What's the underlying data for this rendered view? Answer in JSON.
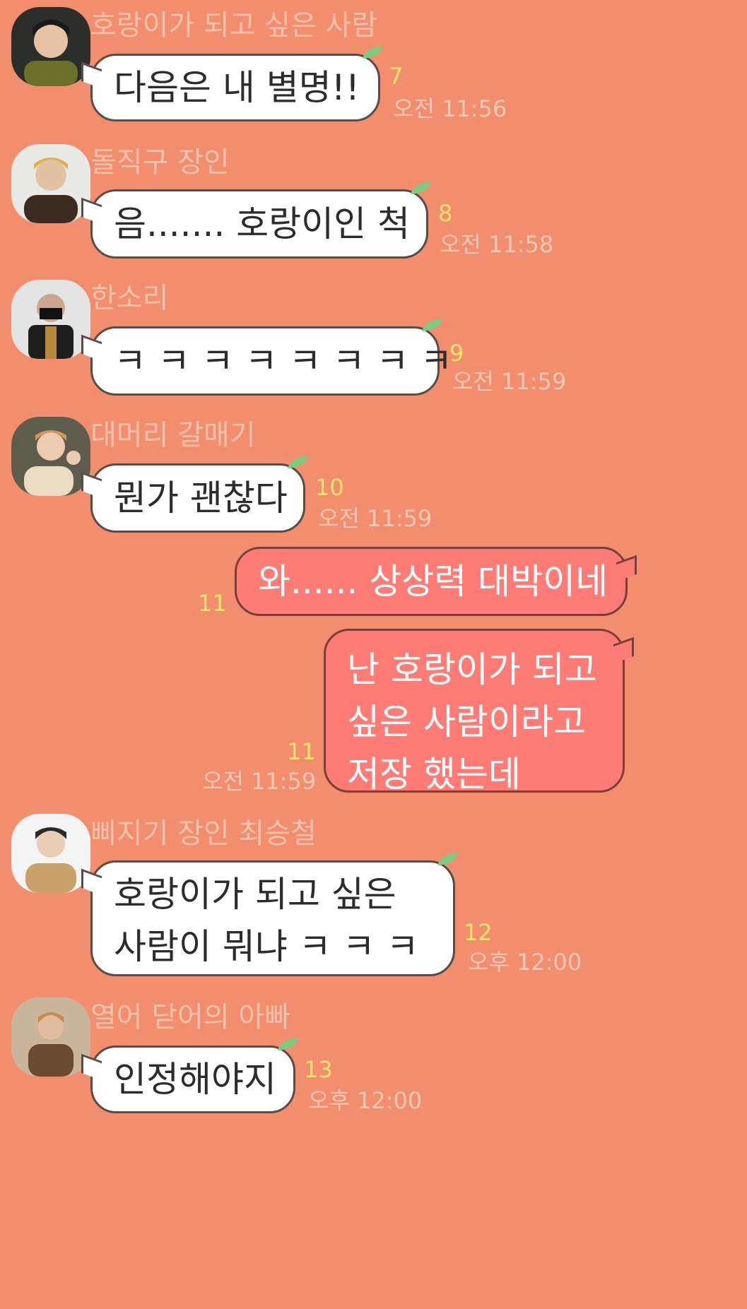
{
  "messages": [
    {
      "sender": "호랑이가 되고 싶은 사람",
      "text": "다음은 내 별명!!",
      "count": "7",
      "time": "오전 11:56"
    },
    {
      "sender": "돌직구 장인",
      "text": "음....... 호랑이인 척",
      "count": "8",
      "time": "오전 11:58"
    },
    {
      "sender": "한소리",
      "text": "ㅋ ㅋ ㅋ ㅋ ㅋ ㅋ ㅋ ㅋ",
      "count": "9",
      "time": "오전 11:59"
    },
    {
      "sender": "대머리 갈매기",
      "text": "뭔가 괜찮다",
      "count": "10",
      "time": "오전 11:59"
    },
    {
      "text": "와...... 상상력 대박이네",
      "count": "11"
    },
    {
      "line1": "난 호랑이가 되고",
      "line2": "싶은 사람이라고",
      "line3": "저장 했는데",
      "count": "11",
      "time": "오전 11:59"
    },
    {
      "sender": "삐지기 장인 최승철",
      "line1": "호랑이가 되고 싶은",
      "line2": "사람이 뭐냐 ㅋ ㅋ ㅋ",
      "count": "12",
      "time": "오후 12:00"
    },
    {
      "sender": "열어 닫어의 아빠",
      "text": "인정해야지",
      "count": "13",
      "time": "오후 12:00"
    }
  ],
  "colors": {
    "background": "#F28E6E",
    "bubble_incoming": "#FFFFFF",
    "bubble_outgoing": "#FF7B76",
    "unread_count": "#FFE66B",
    "sender_name": "#F7C1AE",
    "timestamp": "#F8C8B7"
  },
  "icons": {
    "leaf": "leaf-icon"
  }
}
